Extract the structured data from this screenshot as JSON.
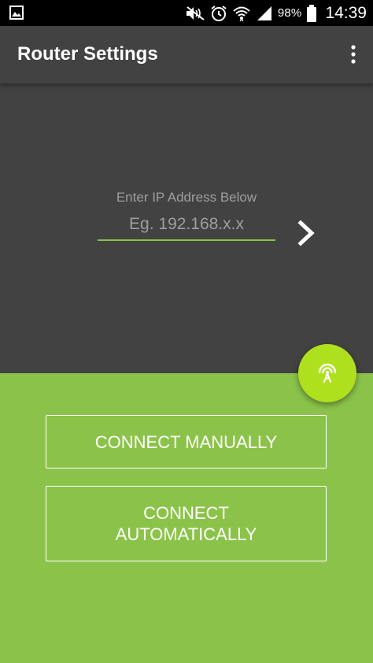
{
  "status_bar": {
    "battery_percent": "98%",
    "time": "14:39",
    "icons": [
      "gallery-icon",
      "mute-icon",
      "alarm-icon",
      "wifi-icon",
      "signal-icon",
      "battery-icon"
    ]
  },
  "app_bar": {
    "title": "Router Settings",
    "menu_icon": "more-vert-icon"
  },
  "ip_entry": {
    "label": "Enter IP Address Below",
    "placeholder": "Eg. 192.168.x.x",
    "value": "",
    "submit_icon": "chevron-right-icon"
  },
  "fab": {
    "icon": "broadcast-antenna-icon"
  },
  "buttons": {
    "connect_manually": "CONNECT MANUALLY",
    "connect_automatically": "CONNECT AUTOMATICALLY"
  },
  "colors": {
    "status_bar": "#000000",
    "app_bar": "#424242",
    "panel": "#424242",
    "accent_green": "#8bc34a",
    "fab_green": "#aee01e",
    "text_white": "#ffffff",
    "hint_grey": "#9e9e9e"
  }
}
